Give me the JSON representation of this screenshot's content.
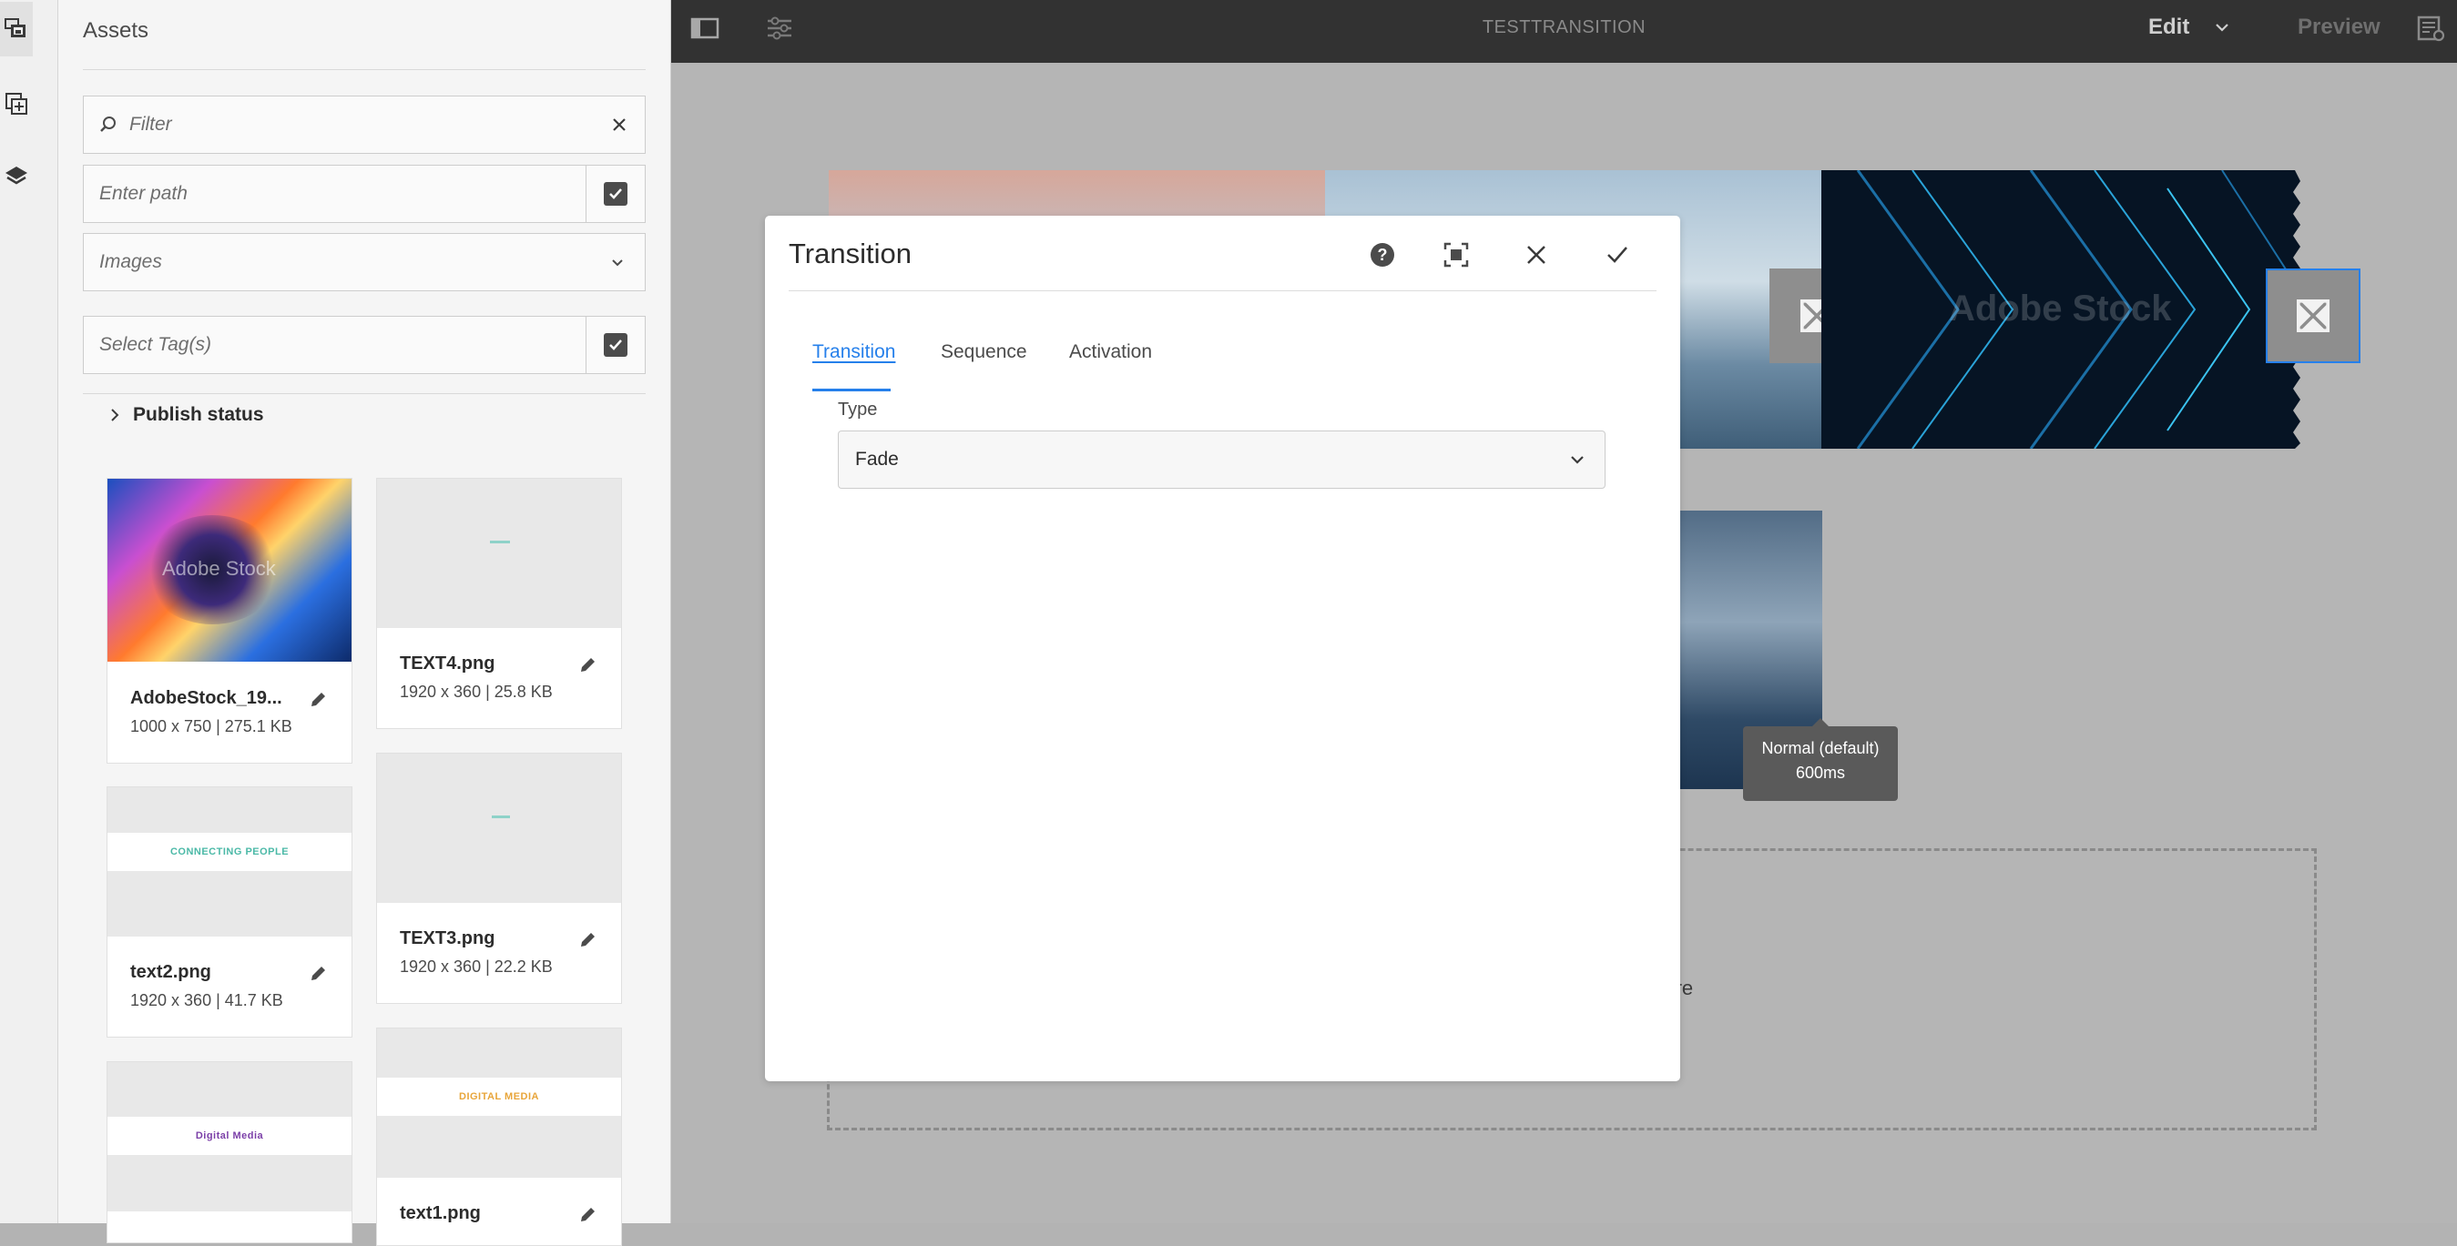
{
  "assets_panel": {
    "title": "Assets",
    "filter_placeholder": "Filter",
    "path_placeholder": "Enter path",
    "type_select_value": "Images",
    "tags_placeholder": "Select Tag(s)",
    "publish_status_label": "Publish status"
  },
  "assets": [
    {
      "name": "AdobeStock_19...",
      "meta": "1000 x 750 | 275.1 KB",
      "watermark": "Adobe Stock",
      "thumb_type": "swirl"
    },
    {
      "name": "TEXT4.png",
      "meta": "1920 x 360 | 25.8 KB",
      "thumb_type": "text"
    },
    {
      "name": "text2.png",
      "meta": "1920 x 360 | 41.7 KB",
      "thumb_text": "CONNECTING PEOPLE",
      "thumb_color": "#4bb9a7"
    },
    {
      "name": "TEXT3.png",
      "meta": "1920 x 360 | 22.2 KB",
      "thumb_type": "text"
    },
    {
      "name": "",
      "meta": "",
      "thumb_text": "Digital Media",
      "thumb_color": "#7b3fa8"
    },
    {
      "name": "text1.png",
      "meta": "",
      "thumb_text": "DIGITAL MEDIA",
      "thumb_color": "#e8a53a"
    }
  ],
  "topbar": {
    "page_title": "TESTTRANSITION",
    "edit_label": "Edit",
    "preview_label": "Preview"
  },
  "canvas": {
    "slide_watermark": "Adobe Stock",
    "drop_text": "s here",
    "tooltip_line1": "Normal (default)",
    "tooltip_line2": "600ms"
  },
  "dialog": {
    "title": "Transition",
    "tabs": [
      {
        "label": "Transition",
        "active": true
      },
      {
        "label": "Sequence",
        "active": false
      },
      {
        "label": "Activation",
        "active": false
      }
    ],
    "type_label": "Type",
    "type_value": "Fade"
  },
  "colors": {
    "accent": "#2680eb",
    "topbar": "#323232",
    "canvas": "#b5b5b5"
  }
}
